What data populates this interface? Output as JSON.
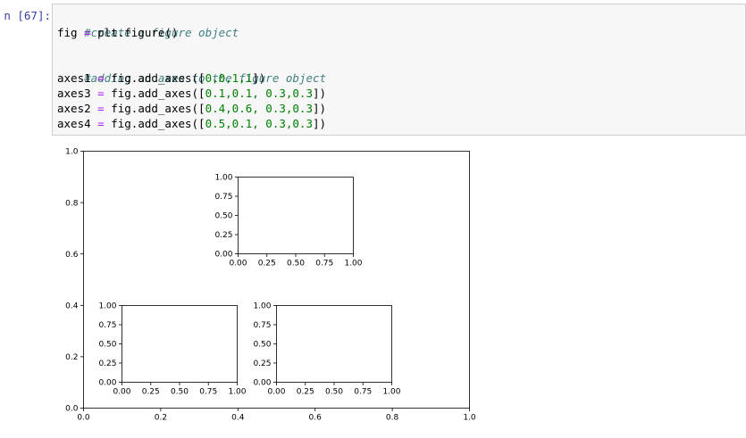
{
  "cell": {
    "prompt": "n [67]:",
    "lines": [
      {
        "comment": "#create a figure object"
      },
      {
        "var": "fig",
        "op": " = ",
        "code": "plt.figure()"
      },
      {},
      {
        "comment": "#adding an axes to the figure object"
      },
      {
        "var": "axes1",
        "op": " = ",
        "code": "fig.add_axes([",
        "nums": "0,0,1,1",
        "end": "])"
      },
      {
        "var": "axes3",
        "op": " = ",
        "code": "fig.add_axes([",
        "nums": "0.1,0.1, 0.3,0.3",
        "end": "])"
      },
      {
        "var": "axes2",
        "op": " = ",
        "code": "fig.add_axes([",
        "nums": "0.4,0.6, 0.3,0.3",
        "end": "])"
      },
      {
        "var": "axes4",
        "op": " = ",
        "code": "fig.add_axes([",
        "nums": "0.5,0.1, 0.3,0.3",
        "end": "])"
      }
    ]
  },
  "chart_data": [
    {
      "type": "axes",
      "name": "axes1",
      "xlim": [
        0,
        1
      ],
      "ylim": [
        0,
        1
      ],
      "xticks": [
        "0.0",
        "0.2",
        "0.4",
        "0.6",
        "0.8",
        "1.0"
      ],
      "yticks": [
        "0.0",
        "0.2",
        "0.4",
        "0.6",
        "0.8",
        "1.0"
      ]
    },
    {
      "type": "axes",
      "name": "axes2",
      "xlim": [
        0,
        1
      ],
      "ylim": [
        0,
        1
      ],
      "xticks": [
        "0.00",
        "0.25",
        "0.50",
        "0.75",
        "1.00"
      ],
      "yticks": [
        "0.00",
        "0.25",
        "0.50",
        "0.75",
        "1.00"
      ]
    },
    {
      "type": "axes",
      "name": "axes3",
      "xlim": [
        0,
        1
      ],
      "ylim": [
        0,
        1
      ],
      "xticks": [
        "0.00",
        "0.25",
        "0.50",
        "0.75",
        "1.00"
      ],
      "yticks": [
        "0.00",
        "0.25",
        "0.50",
        "0.75",
        "1.00"
      ]
    },
    {
      "type": "axes",
      "name": "axes4",
      "xlim": [
        0,
        1
      ],
      "ylim": [
        0,
        1
      ],
      "xticks": [
        "0.00",
        "0.25",
        "0.50",
        "0.75",
        "1.00"
      ],
      "yticks": [
        "0.00",
        "0.25",
        "0.50",
        "0.75",
        "1.00"
      ]
    }
  ]
}
